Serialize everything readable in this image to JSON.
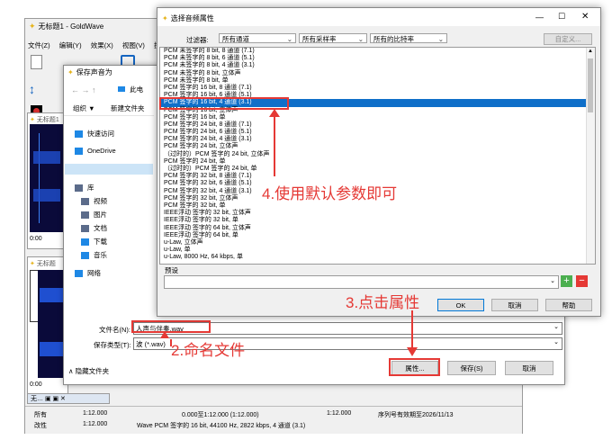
{
  "goldwave": {
    "title": "无标题1 - GoldWave",
    "menu": [
      "文件(Z)",
      "编辑(Y)",
      "效果(X)",
      "视图(V)",
      "控"
    ],
    "tab_label": "无标题1",
    "tab_label2": "无标题",
    "tab_label3": "无",
    "time_a": "0:00",
    "time_b": "0:00",
    "time_c": "0:00",
    "status": {
      "row1": [
        "所有",
        "1:12.000",
        "0.000至1:12.000 (1:12.000)",
        "1:12.000",
        "序列号有效期至2026/11/13"
      ],
      "row2": [
        "改性",
        "1:12.000",
        "Wave PCM 签字的 16 bit, 44100 Hz, 2822 kbps, 4 通道 (3.1)"
      ]
    }
  },
  "save_dialog": {
    "title": "保存声音为",
    "breadcrumb": "此电",
    "organize": "组织 ▼",
    "new_folder": "新建文件夹",
    "nav": [
      {
        "label": "快速访问",
        "icon": "star-icon"
      },
      {
        "label": "OneDrive",
        "icon": "cloud-icon"
      },
      {
        "label": "此电脑",
        "icon": "computer-icon"
      },
      {
        "label": "库",
        "icon": "library-icon"
      },
      {
        "label": "视频",
        "icon": "video-icon"
      },
      {
        "label": "图片",
        "icon": "picture-icon"
      },
      {
        "label": "文档",
        "icon": "document-icon"
      },
      {
        "label": "下载",
        "icon": "download-icon"
      },
      {
        "label": "音乐",
        "icon": "music-icon"
      },
      {
        "label": "网络",
        "icon": "network-icon"
      }
    ],
    "filename_label": "文件名(N):",
    "filename_value": "人声与伴奏.wav",
    "filetype_label": "保存类型(T):",
    "filetype_value": "波 (*.wav)",
    "hide_folders": "隐藏文件夹",
    "properties_btn": "属性...",
    "save_btn": "保存(S)",
    "cancel_btn": "取消"
  },
  "props_dialog": {
    "title": "选择音频属性",
    "filter_label": "过滤器:",
    "filter_channels": "所有通道",
    "filter_rates": "所有采样率",
    "filter_bitrates": "所有的比特率",
    "custom_btn": "自定义...",
    "formats": [
      "PCM 未签字的 8 bit, 8 通道 (7.1)",
      "PCM 未签字的 8 bit, 6 通道 (5.1)",
      "PCM 未签字的 8 bit, 4 通道 (3.1)",
      "PCM 未签字的 8 bit, 立体声",
      "PCM 未签字的 8 bit, 单",
      "PCM 签字的 16 bit, 8 通道 (7.1)",
      "PCM 签字的 16 bit, 6 通道 (5.1)",
      "PCM 签字的 16 bit, 4 通道 (3.1)",
      "PCM 签字的 16 bit, 立体声",
      "PCM 签字的 16 bit, 单",
      "PCM 签字的 24 bit, 8 通道 (7.1)",
      "PCM 签字的 24 bit, 6 通道 (5.1)",
      "PCM 签字的 24 bit, 4 通道 (3.1)",
      "PCM 签字的 24 bit, 立体声",
      "（过时的）PCM 签字的 24 bit, 立体声",
      "PCM 签字的 24 bit, 单",
      "（过时的）PCM 签字的 24 bit, 单",
      "PCM 签字的 32 bit, 8 通道 (7.1)",
      "PCM 签字的 32 bit, 6 通道 (5.1)",
      "PCM 签字的 32 bit, 4 通道 (3.1)",
      "PCM 签字的 32 bit, 立体声",
      "PCM 签字的 32 bit, 单",
      "IEEE浮动 签字的 32 bit, 立体声",
      "IEEE浮动 签字的 32 bit, 单",
      "IEEE浮动 签字的 64 bit, 立体声",
      "IEEE浮动 签字的 64 bit, 单",
      "u-Law, 立体声",
      "u-Law, 单",
      "u-Law, 8000 Hz, 64 kbps, 单"
    ],
    "selected_index": 7,
    "preset_label": "预设",
    "ok_btn": "OK",
    "cancel_btn": "取消",
    "help_btn": "帮助"
  },
  "annotations": {
    "step4": "4.使用默认参数即可",
    "step3": "3.点击属性",
    "step2": "2.命名文件",
    "color": "#e53935"
  }
}
